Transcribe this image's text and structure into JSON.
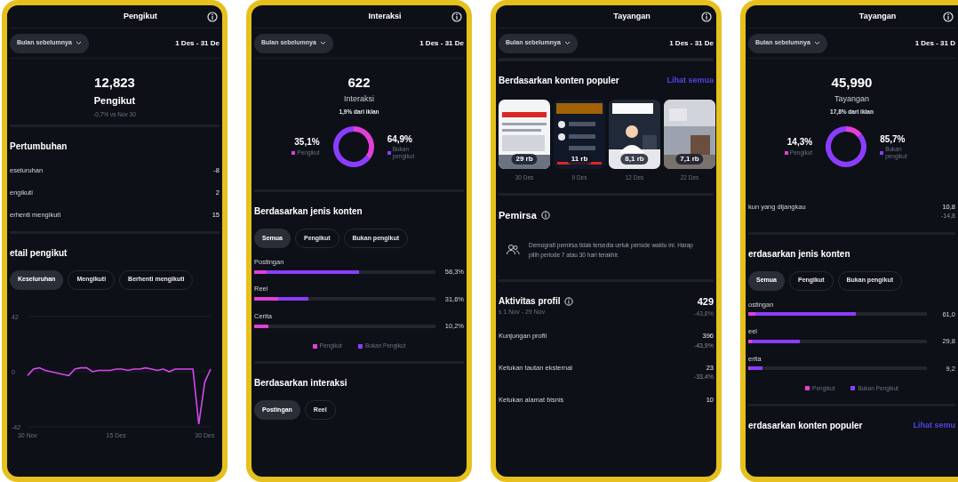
{
  "panels": [
    {
      "title": "Pengikut",
      "filter": {
        "label": "Bulan sebelumnya",
        "date": "1 Des - 31 De"
      },
      "sections": [
        {
          "kind": "total",
          "value": "12,823",
          "label": "Pengikut",
          "bold": true,
          "sub": "-0,7% vs Nov 30"
        },
        {
          "kind": "metrics",
          "heading": "Pertumbuhan",
          "rows": [
            {
              "label": "eseluruhan",
              "value": "-8"
            },
            {
              "label": "engikuti",
              "value": "2"
            },
            {
              "label": "erhenti mengikuti",
              "value": "15"
            }
          ]
        },
        {
          "kind": "chips",
          "heading": "etail pengikut",
          "chips": [
            {
              "label": "Keseluruhan",
              "selected": true
            },
            {
              "label": "Mengikuti",
              "selected": false
            },
            {
              "label": "Berhenti mengikuti",
              "selected": false
            }
          ]
        },
        {
          "kind": "chart",
          "chart_data": {
            "type": "line",
            "x": [
              0,
              1,
              2,
              3,
              4,
              5,
              6,
              7,
              8,
              9,
              10,
              11,
              12,
              13,
              14,
              15,
              16,
              17,
              18,
              19,
              20,
              21,
              22,
              23,
              24,
              25,
              26,
              27,
              28,
              29,
              30,
              31
            ],
            "series": [
              {
                "color": "#d946ef",
                "values": [
                  -3,
                  2,
                  3,
                  1,
                  0,
                  -1,
                  -2,
                  -3,
                  2,
                  3,
                  3,
                  0,
                  1,
                  1,
                  1,
                  2,
                  2,
                  1,
                  2,
                  2,
                  3,
                  2,
                  1,
                  2,
                  0,
                  2,
                  2,
                  2,
                  2,
                  -40,
                  -8,
                  2
                ]
              }
            ],
            "xlim": [
              0,
              31
            ],
            "ylim": [
              -42,
              42
            ],
            "yticks": [
              -42,
              0,
              42
            ],
            "xticks": [
              {
                "value": 0,
                "label": "30 Nov"
              },
              {
                "value": 15,
                "label": "15 Des"
              },
              {
                "value": 30,
                "label": "30 Des"
              }
            ]
          }
        }
      ]
    },
    {
      "title": "Interaksi",
      "filter": {
        "label": "Bulan sebelumnya",
        "date": "1 Des - 31 De"
      },
      "sections": [
        {
          "kind": "total",
          "value": "622",
          "label": "Interaksi",
          "bold": false,
          "sub": "1,9% dari iklan"
        },
        {
          "kind": "donut",
          "left": {
            "value": "35,1%"
          },
          "right": {
            "value": "64,9%"
          },
          "chart_data": {
            "type": "donut",
            "categories": [
              "Pengikut",
              "Bukan pengikut"
            ],
            "values": [
              35.1,
              64.9
            ],
            "legend": "bottom left"
          }
        },
        {
          "kind": "bars",
          "heading": "Berdasarkan jenis konten",
          "chips": [
            {
              "label": "Semua",
              "selected": true
            },
            {
              "label": "Pengikut",
              "selected": false
            },
            {
              "label": "Bukan pengikut",
              "selected": false
            }
          ],
          "rows": [
            {
              "label": "Postingan",
              "value": "58,3%",
              "segments": [
                {
                  "level": 0.58,
                  "color": "#8b3dff"
                },
                {
                  "level": 0.07,
                  "color": "#e23fd6"
                }
              ]
            },
            {
              "label": "Reel",
              "value": "31,6%",
              "segments": [
                {
                  "level": 0.3,
                  "color": "#8b3dff"
                },
                {
                  "level": 0.13,
                  "color": "#e23fd6"
                }
              ]
            },
            {
              "label": "Cerita",
              "value": "10,2%",
              "segments": [
                {
                  "level": 0.08,
                  "color": "#e23fd6"
                }
              ]
            }
          ],
          "legend": [
            {
              "label": "Pengikut",
              "color": "#e23fd6"
            },
            {
              "label": "Bukan Pengikut",
              "color": "#8b3dff"
            }
          ]
        },
        {
          "kind": "chips",
          "heading": "Berdasarkan interaksi",
          "chips": [
            {
              "label": "Postingan",
              "selected": true
            },
            {
              "label": "Reel",
              "selected": false
            }
          ]
        }
      ]
    },
    {
      "title": "Tayangan",
      "filter": {
        "label": "Bulan sebelumnya",
        "date": "1 Des - 31 De"
      },
      "sections": [
        {
          "kind": "popular",
          "heading": "Berdasarkan konten populer",
          "link": "Lihat semua",
          "posts": [
            {
              "count": "29 rb",
              "date": "30 Des"
            },
            {
              "count": "11 rb",
              "date": "9 Des"
            },
            {
              "count": "8,1 rb",
              "date": "12 Des"
            },
            {
              "count": "7,1 rb",
              "date": "22 Des"
            }
          ]
        },
        {
          "kind": "notice",
          "heading": "Pemirsa",
          "info": true,
          "text": "Demografi pemirsa tidak tersedia untuk periode waktu ini. Harap pilih periode 7 atau 30 hari terakhir."
        },
        {
          "kind": "metrics",
          "heading": "Aktivitas profil",
          "info": true,
          "value": "429",
          "sub": "s 1 Nov - 29 Nov",
          "change": "-43,8%",
          "rows": [
            {
              "label": "Kunjungan profil",
              "value": "396",
              "sub": "-43,9%"
            },
            {
              "label": "Ketukan tautan eksternal",
              "value": "23",
              "sub": "-33,4%"
            },
            {
              "label": "Ketukan alamat bisnis",
              "value": "10"
            }
          ]
        }
      ]
    },
    {
      "title": "Tayangan",
      "filter": {
        "label": "Bulan sebelumnya",
        "date": "1 Des - 31 D"
      },
      "sections": [
        {
          "kind": "total",
          "value": "45,990",
          "label": "Tayangan",
          "bold": false,
          "sub": "17,8% dari iklan"
        },
        {
          "kind": "donut",
          "left": {
            "value": "14,3%"
          },
          "right": {
            "value": "85,7%"
          },
          "chart_data": {
            "type": "donut",
            "categories": [
              "Pengikut",
              "Bukan pengikut"
            ],
            "values": [
              14.3,
              85.7
            ],
            "legend": "bottom left"
          }
        },
        {
          "kind": "metrics",
          "rows": [
            {
              "label": "kun yang dijangkau",
              "value": "10,8",
              "sub": "-14,8"
            }
          ]
        },
        {
          "kind": "bars",
          "heading": "erdasarkan jenis konten",
          "chips": [
            {
              "label": "Semua",
              "selected": true
            },
            {
              "label": "Pengikut",
              "selected": false
            },
            {
              "label": "Bukan pengikut",
              "selected": false
            }
          ],
          "rows": [
            {
              "label": "ostingan",
              "value": "61,0",
              "segments": [
                {
                  "level": 0.6,
                  "color": "#8b3dff"
                },
                {
                  "level": 0.04,
                  "color": "#e23fd6"
                }
              ]
            },
            {
              "label": "eel",
              "value": "29,8",
              "segments": [
                {
                  "level": 0.29,
                  "color": "#8b3dff"
                },
                {
                  "level": 0.02,
                  "color": "#e23fd6"
                }
              ]
            },
            {
              "label": "erita",
              "value": "9,2",
              "segments": [
                {
                  "level": 0.08,
                  "color": "#8b3dff"
                },
                {
                  "level": 0.01,
                  "color": "#e23fd6"
                }
              ]
            }
          ],
          "legend": [
            {
              "label": "Pengikut",
              "color": "#e23fd6"
            },
            {
              "label": "Bukan Pengikut",
              "color": "#8b3dff"
            }
          ]
        },
        {
          "kind": "popular",
          "heading": "erdasarkan konten populer",
          "link": "Lihat semu"
        }
      ]
    }
  ]
}
